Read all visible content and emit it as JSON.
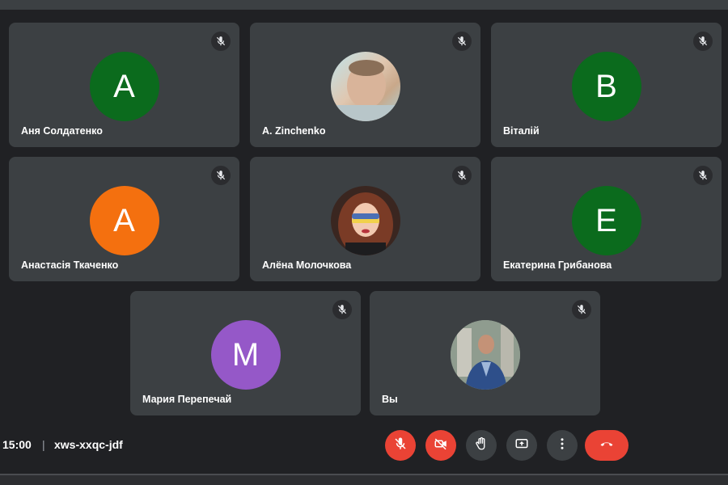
{
  "participants": [
    {
      "name": "Аня Солдатенко",
      "initial": "A",
      "avatar_color": "#0b6b1d",
      "muted": true
    },
    {
      "name": "A. Zinchenko",
      "initial": "",
      "avatar_color": "#c9b9a4",
      "muted": true
    },
    {
      "name": "Віталій",
      "initial": "B",
      "avatar_color": "#0b6b1d",
      "muted": true
    },
    {
      "name": "Анастасія Ткаченко",
      "initial": "A",
      "avatar_color": "#f4700f",
      "muted": true
    },
    {
      "name": "Алёна Молочкова",
      "initial": "",
      "avatar_color": "#5a3a2e",
      "muted": true
    },
    {
      "name": "Екатерина Грибанова",
      "initial": "E",
      "avatar_color": "#0b6b1d",
      "muted": true
    },
    {
      "name": "Мария Перепечай",
      "initial": "M",
      "avatar_color": "#9558c8",
      "muted": true
    },
    {
      "name": "Вы",
      "initial": "",
      "avatar_color": "#8a9aa6",
      "muted": true
    }
  ],
  "meeting": {
    "time": "15:00",
    "separator": "|",
    "code": "xws-xxqc-jdf"
  },
  "controls": {
    "mic": "mic-off-icon",
    "camera": "camera-off-icon",
    "hand": "raise-hand-icon",
    "present": "present-screen-icon",
    "more": "more-options-icon",
    "end": "end-call-icon"
  },
  "colors": {
    "background": "#202124",
    "tile": "#3c4043",
    "danger": "#ea4335"
  }
}
